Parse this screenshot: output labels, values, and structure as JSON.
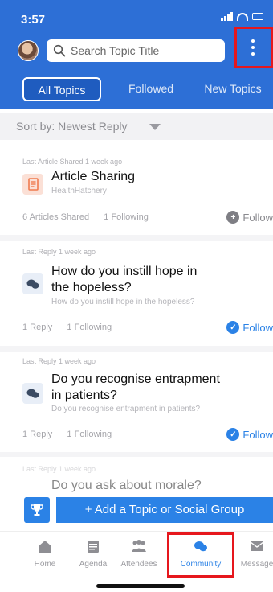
{
  "status": {
    "time": "3:57"
  },
  "search": {
    "placeholder": "Search Topic Title"
  },
  "tabs": [
    {
      "label": "All Topics"
    },
    {
      "label": "Followed"
    },
    {
      "label": "New Topics"
    }
  ],
  "sort": {
    "label": "Sort by: Newest Reply"
  },
  "cards": [
    {
      "meta": "Last Article Shared 1 week ago",
      "title": "Article Sharing",
      "subtitle": "HealthHatchery",
      "stat1": "6 Articles Shared",
      "stat2": "1 Following",
      "follow": "Follow"
    },
    {
      "meta": "Last Reply 1 week ago",
      "title_line1": "How do you instill hope in",
      "title_line2": "the hopeless?",
      "subtitle": "How do you instill hope in the hopeless?",
      "stat1": "1 Reply",
      "stat2": "1 Following",
      "follow": "Follow"
    },
    {
      "meta": "Last Reply 1 week ago",
      "title_line1": "Do you recognise entrapment",
      "title_line2": "in patients?",
      "subtitle": "Do you recognise entrapment in patients?",
      "stat1": "1 Reply",
      "stat2": "1 Following",
      "follow": "Follow"
    },
    {
      "meta": "Last Reply 1 week ago",
      "title": "Do you ask about morale?"
    }
  ],
  "add_button": {
    "label": "+ Add a Topic or Social Group"
  },
  "nav": [
    {
      "label": "Home"
    },
    {
      "label": "Agenda"
    },
    {
      "label": "Attendees"
    },
    {
      "label": "Community"
    },
    {
      "label": "Message"
    }
  ],
  "colors": {
    "header": "#2d6fd6",
    "accent": "#2b82e6",
    "highlight": "#e6171d",
    "article_icon": "#f07b4f"
  },
  "icons": [
    "avatar",
    "search-icon",
    "more-vertical-icon",
    "sort-caret-icon",
    "article-icon",
    "chat-bubbles-icon",
    "plus-circle-icon",
    "check-circle-icon",
    "trophy-icon",
    "home-icon",
    "agenda-icon",
    "attendees-icon",
    "community-icon",
    "message-icon"
  ]
}
